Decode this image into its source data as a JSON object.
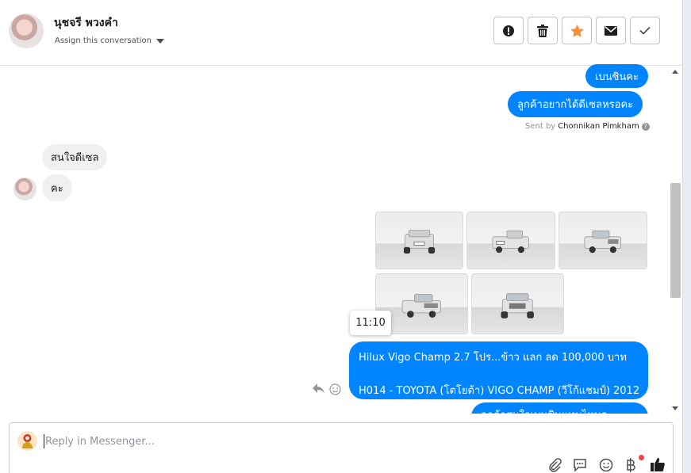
{
  "contact": {
    "name": "นุชจรี พวงคำ",
    "assign_label": "Assign this conversation"
  },
  "header_actions": [
    {
      "name": "spam-button",
      "icon": "alert-circle-icon"
    },
    {
      "name": "delete-button",
      "icon": "trash-icon"
    },
    {
      "name": "star-button",
      "icon": "star-icon",
      "color": "#f7923b"
    },
    {
      "name": "mark-unread-button",
      "icon": "envelope-icon"
    },
    {
      "name": "mark-done-button",
      "icon": "checkmark-icon"
    }
  ],
  "messages": {
    "out_1": "เบนซินคะ",
    "out_2": "ลูกค้าอยากได้ดีเซลหรอคะ",
    "sent_by_prefix": "Sent by",
    "sent_by_name": "Chonnikan Pimkham",
    "in_1": "สนใจดีเซล",
    "in_2": "คะ",
    "tooltip_time": "11:10",
    "listing_line1": "Hilux Vigo Champ 2.7 โปร...ข้าว แลก ลด 100,000 บาท",
    "listing_line2": "H014 - TOYOTA (โตโยต้า) VIGO CHAMP (วีโก้แชมป์) 2012",
    "out_cut": "ลูกค้าสนใจเบนซินแทนไหมคะ"
  },
  "photos": [
    "truck-rear-view",
    "truck-rear-angle-view",
    "truck-front-angle-view",
    "truck-front-left-view",
    "truck-front-view"
  ],
  "composer": {
    "placeholder": "Reply in Messenger..."
  },
  "colors": {
    "messenger_blue": "#0084ff",
    "incoming_gray": "#f1f0f0",
    "notification_red": "#fa3e3e"
  }
}
